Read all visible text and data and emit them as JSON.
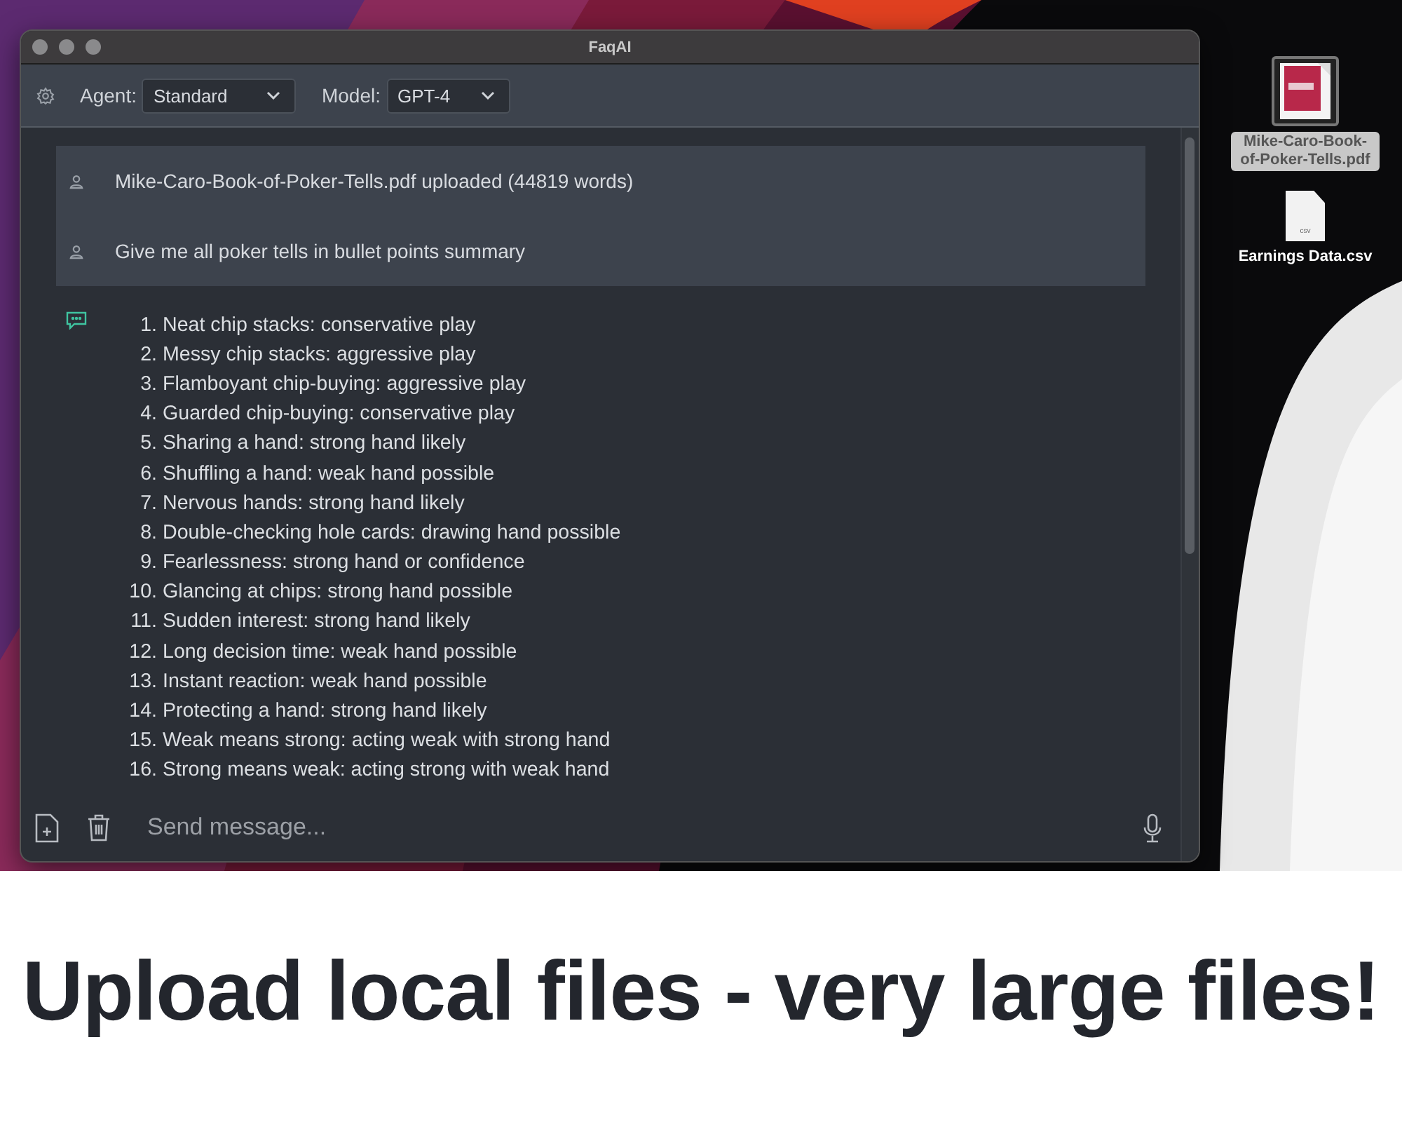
{
  "window": {
    "title": "FaqAI"
  },
  "toolbar": {
    "agent_label": "Agent:",
    "agent": "Standard",
    "model_label": "Model:",
    "model": "GPT-4"
  },
  "messages": [
    {
      "kind": "user",
      "text": "Mike-Caro-Book-of-Poker-Tells.pdf uploaded (44819 words)"
    },
    {
      "kind": "user",
      "text": "Give me all poker tells in bullet points summary"
    }
  ],
  "response": {
    "items": [
      {
        "number": "1.",
        "text": "Neat chip stacks: conservative play"
      },
      {
        "number": "2.",
        "text": "Messy chip stacks: aggressive play"
      },
      {
        "number": "3.",
        "text": "Flamboyant chip-buying: aggressive play"
      },
      {
        "number": "4.",
        "text": "Guarded chip-buying: conservative play"
      },
      {
        "number": "5.",
        "text": "Sharing a hand: strong hand likely"
      },
      {
        "number": "6.",
        "text": "Shuffling a hand: weak hand possible"
      },
      {
        "number": "7.",
        "text": "Nervous hands: strong hand likely"
      },
      {
        "number": "8.",
        "text": "Double-checking hole cards: drawing hand possible"
      },
      {
        "number": "9.",
        "text": "Fearlessness: strong hand or confidence"
      },
      {
        "number": "10.",
        "text": "Glancing at chips: strong hand possible"
      },
      {
        "number": "11.",
        "text": "Sudden interest: strong hand likely"
      },
      {
        "number": "12.",
        "text": "Long decision time: weak hand possible"
      },
      {
        "number": "13.",
        "text": "Instant reaction: weak hand possible"
      },
      {
        "number": "14.",
        "text": "Protecting a hand: strong hand likely"
      },
      {
        "number": "15.",
        "text": "Weak means strong: acting weak with strong hand"
      },
      {
        "number": "16.",
        "text": "Strong means weak: acting strong with weak hand"
      }
    ]
  },
  "composer": {
    "placeholder": "Send message..."
  },
  "desktop_icons": [
    {
      "kind": "pdf",
      "label": "Mike-Caro-Book-of-Poker-Tells.pdf",
      "selected": true
    },
    {
      "kind": "csv",
      "label": "Earnings Data.csv",
      "icon_text": "csv",
      "selected": false
    }
  ],
  "caption": "Upload local files - very large files!"
}
